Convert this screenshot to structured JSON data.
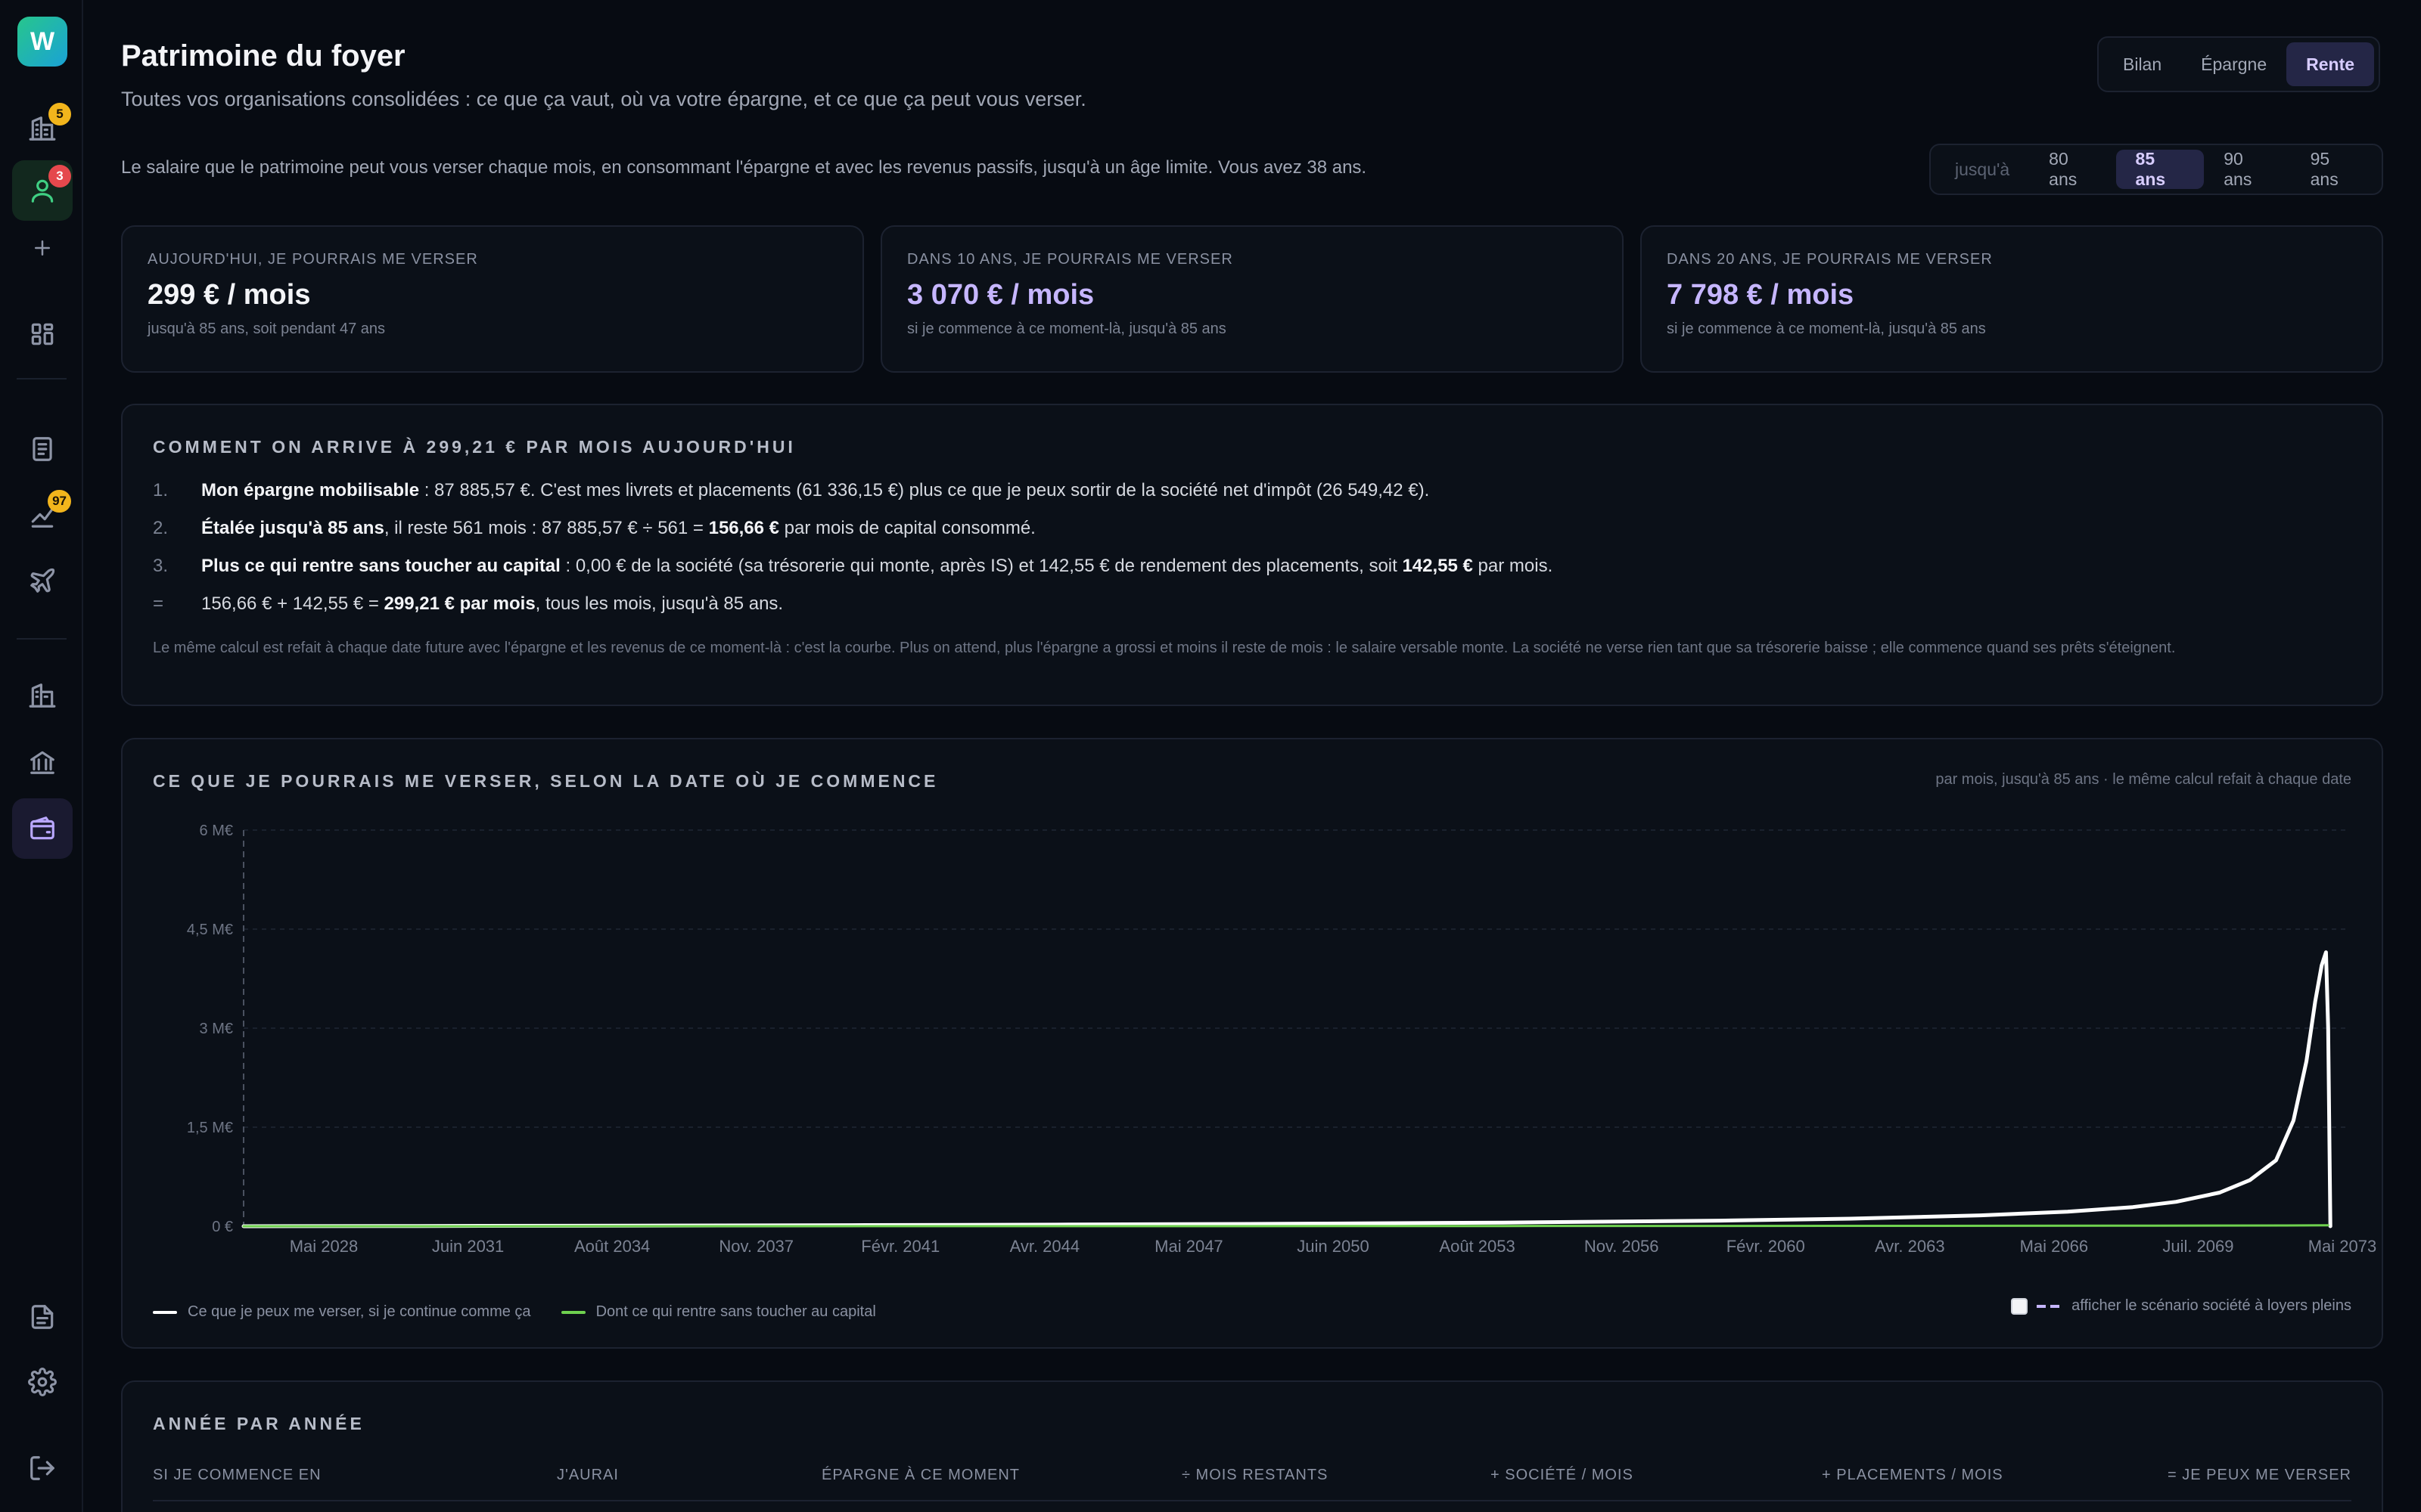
{
  "sidebar": {
    "logo": "W",
    "badges": {
      "buildings": "5",
      "user": "3",
      "transfers": "97"
    }
  },
  "header": {
    "title": "Patrimoine du foyer",
    "subtitle": "Toutes vos organisations consolidées : ce que ça vaut, où va votre épargne, et ce que ça peut vous verser.",
    "view_tabs": [
      "Bilan",
      "Épargne",
      "Rente"
    ],
    "active_view": "Rente"
  },
  "intro": "Le salaire que le patrimoine peut vous verser chaque mois, en consommant l'épargne et avec les revenus passifs, jusqu'à un âge limite. Vous avez 38 ans.",
  "age_selector": {
    "prefix": "jusqu'à",
    "options": [
      "80 ans",
      "85 ans",
      "90 ans",
      "95 ans"
    ],
    "selected": "85 ans"
  },
  "kpis": [
    {
      "label": "Aujourd'hui, je pourrais me verser",
      "value": "299 € / mois",
      "note": "jusqu'à 85 ans, soit pendant 47 ans"
    },
    {
      "label": "Dans 10 ans, je pourrais me verser",
      "value": "3 070 € / mois",
      "note": "si je commence à ce moment-là, jusqu'à 85 ans"
    },
    {
      "label": "Dans 20 ans, je pourrais me verser",
      "value": "7 798 € / mois",
      "note": "si je commence à ce moment-là, jusqu'à 85 ans"
    }
  ],
  "calc": {
    "title": "Comment on arrive à 299,21 € par mois aujourd'hui",
    "row1": {
      "num": "1.",
      "bold": "Mon épargne mobilisable",
      "text": " : 87 885,57 €. C'est mes livrets et placements (61 336,15 €) plus ce que je peux sortir de la société net d'impôt (26 549,42 €)."
    },
    "row2": {
      "num": "2.",
      "bold": "Étalée jusqu'à 85 ans",
      "text1": ", il reste 561 mois : 87 885,57 € ÷ 561 = ",
      "bold2": "156,66 €",
      "text2": " par mois de capital consommé."
    },
    "row3": {
      "num": "3.",
      "bold": "Plus ce qui rentre sans toucher au capital",
      "text1": " : 0,00 € de la société (sa trésorerie qui monte, après IS) et 142,55 € de rendement des placements, soit ",
      "bold2": "142,55 €",
      "text2": " par mois."
    },
    "row4": {
      "num": "=",
      "text1": "156,66 € + 142,55 € = ",
      "bold": "299,21 € par mois",
      "text2": ", tous les mois, jusqu'à 85 ans."
    },
    "note": "Le même calcul est refait à chaque date future avec l'épargne et les revenus de ce moment-là : c'est la courbe. Plus on attend, plus l'épargne a grossi et moins il reste de mois : le salaire versable monte. La société ne verse rien tant que sa trésorerie baisse ; elle commence quand ses prêts s'éteignent."
  },
  "chart": {
    "title": "Ce que je pourrais me verser, selon la date où je commence",
    "caption": "par mois, jusqu'à 85 ans · le même calcul refait à chaque date",
    "toggle_label": "afficher le scénario société à loyers pleins",
    "toggle_checked": false
  },
  "chart_data": {
    "type": "line",
    "ylim": [
      0,
      6000000
    ],
    "y_ticks": [
      "0 €",
      "1,5 M€",
      "3 M€",
      "4,5 M€",
      "6 M€"
    ],
    "x_ticks": [
      "Mai 2028",
      "Juin 2031",
      "Août 2034",
      "Nov. 2037",
      "Févr. 2041",
      "Avr. 2044",
      "Mai 2047",
      "Juin 2050",
      "Août 2053",
      "Nov. 2056",
      "Févr. 2060",
      "Avr. 2063",
      "Mai 2066",
      "Juil. 2069",
      "Mai 2073"
    ],
    "xlim": [
      2026.0,
      2074.5
    ],
    "colors": {
      "main": "#ffffff",
      "passive": "#6fd14f",
      "grid": "#1a212d"
    },
    "series": [
      {
        "name": "Ce que je peux me verser, si je continue comme ça",
        "x": [
          2026.0,
          2030,
          2035,
          2040,
          2045,
          2050,
          2055,
          2060,
          2063,
          2066,
          2068,
          2069.5,
          2070.5,
          2071.5,
          2072.2,
          2072.8,
          2073.2,
          2073.5,
          2073.7,
          2073.85,
          2073.95,
          2074.0,
          2074.05
        ],
        "y": [
          299,
          4000,
          9000,
          16000,
          25000,
          37000,
          55000,
          85000,
          115000,
          165000,
          220000,
          290000,
          370000,
          510000,
          700000,
          1000000,
          1600000,
          2500000,
          3400000,
          3950000,
          4150000,
          3000000,
          0
        ]
      },
      {
        "name": "Dont ce qui rentre sans toucher au capital",
        "x": [
          2026.0,
          2035,
          2045,
          2055,
          2065,
          2070,
          2073,
          2074.0
        ],
        "y": [
          143,
          600,
          1500,
          3000,
          6000,
          9000,
          12000,
          14000
        ]
      }
    ]
  },
  "table": {
    "title": "Année par année",
    "headers": [
      "Si je commence en",
      "J'aurai",
      "Épargne à ce moment",
      "÷ mois restants",
      "+ Société / mois",
      "+ Placements / mois",
      "= Je peux me verser"
    ]
  }
}
